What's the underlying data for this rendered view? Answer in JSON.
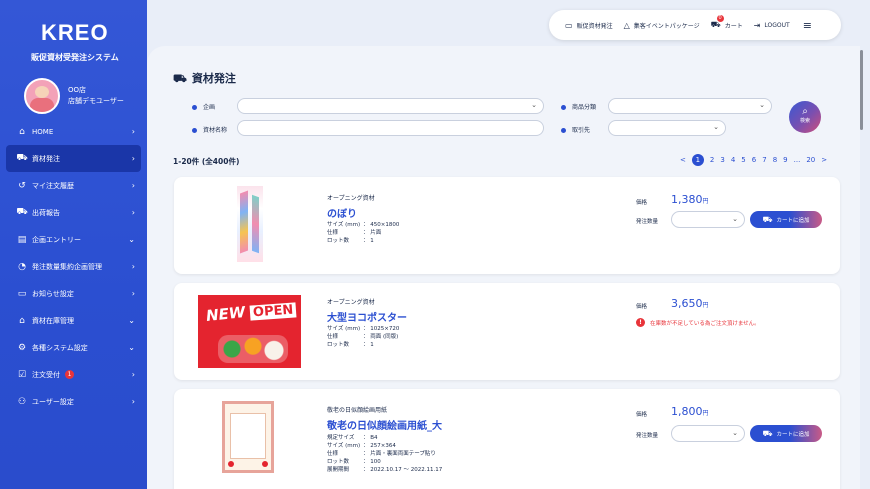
{
  "sidebar": {
    "logo": "KREO",
    "system_name": "販促資材受発注システム",
    "user_line1": "OO店",
    "user_line2": "店舗デモユーザー",
    "items": [
      {
        "label": "HOME",
        "icon": "home-icon"
      },
      {
        "label": "資材発注",
        "icon": "cart-icon",
        "active": true
      },
      {
        "label": "マイ注文履歴",
        "icon": "history-icon"
      },
      {
        "label": "出荷報告",
        "icon": "truck-icon"
      },
      {
        "label": "企画エントリー",
        "icon": "clipboard-icon"
      },
      {
        "label": "発注数量集約企画管理",
        "icon": "gauge-icon"
      },
      {
        "label": "お知らせ設定",
        "icon": "message-icon"
      },
      {
        "label": "資材在庫管理",
        "icon": "warehouse-icon"
      },
      {
        "label": "各種システム設定",
        "icon": "gear-icon"
      },
      {
        "label": "注文受付",
        "icon": "checkbox-icon",
        "badge": "1"
      },
      {
        "label": "ユーザー設定",
        "icon": "users-icon"
      }
    ]
  },
  "topbar": {
    "order": "販促資材発注",
    "event": "集客イベントパッケージ",
    "cart": "カート",
    "cart_badge": "0",
    "logout": "LOGOUT"
  },
  "page": {
    "title": "資材発注",
    "filters": {
      "kikaku": "企画",
      "shohin_bunrui": "商品分類",
      "shizai_mei": "資材名称",
      "torihikisaki": "取引先",
      "search": "検索"
    },
    "count": "1-20件 (全400件)",
    "pager": {
      "prev": "<",
      "pages": [
        "1",
        "2",
        "3",
        "4",
        "5",
        "6",
        "7",
        "8",
        "9"
      ],
      "ellipsis": "...",
      "last": "20",
      "next": ">"
    }
  },
  "labels": {
    "price": "価格",
    "qty": "発注数量",
    "add_cart": "カートに追加",
    "warning": "在庫数が不足している為ご注文頂けません。"
  },
  "products": [
    {
      "category": "オープニング資材",
      "name": "のぼり",
      "price": "1,380",
      "yen": "円",
      "specs": [
        {
          "k": "サイズ (mm)",
          "v": "：  450×1800"
        },
        {
          "k": "仕様",
          "v": "：  片面"
        },
        {
          "k": "ロット数",
          "v": "：  1"
        }
      ]
    },
    {
      "category": "オープニング資材",
      "name": "大型ヨコポスター",
      "price": "3,650",
      "yen": "円",
      "specs": [
        {
          "k": "サイズ (mm)",
          "v": "：  1025×720"
        },
        {
          "k": "仕様",
          "v": "：  両面 (同版)"
        },
        {
          "k": "ロット数",
          "v": "：  1"
        }
      ],
      "poster_text1": "NEW",
      "poster_text2": "OPEN"
    },
    {
      "category": "敬老の日似顔絵画用紙",
      "name": "敬老の日似顔絵画用紙_大",
      "price": "1,800",
      "yen": "円",
      "specs": [
        {
          "k": "規定サイズ",
          "v": "：  B4"
        },
        {
          "k": "サイズ (mm)",
          "v": "：  257×364"
        },
        {
          "k": "仕様",
          "v": "：  片面・裏面両面テープ貼り"
        },
        {
          "k": "ロット数",
          "v": "：  100"
        },
        {
          "k": "展開期間",
          "v": "：  2022.10.17 〜 2022.11.17"
        }
      ]
    }
  ],
  "colors": {
    "primary": "#2b4fd1",
    "danger": "#e8343a",
    "sidebar": "#3457d6"
  }
}
